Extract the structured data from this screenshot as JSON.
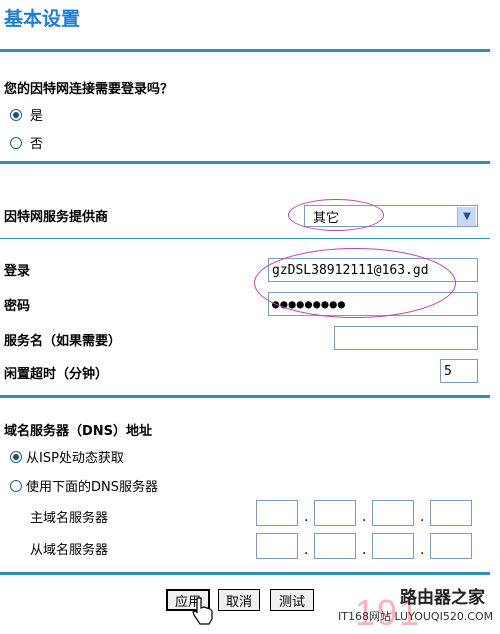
{
  "page": {
    "title": "基本设置"
  },
  "login_required": {
    "question": "您的因特网连接需要登录吗？",
    "options": [
      {
        "label": "是",
        "selected": true
      },
      {
        "label": "否",
        "selected": false
      }
    ]
  },
  "isp": {
    "label": "因特网服务提供商",
    "selected": "其它"
  },
  "account": {
    "login_label": "登录",
    "login_value": "gzDSL38912111@163.gd",
    "password_label": "密码",
    "password_value": "●●●●●●●●●",
    "service_label": "服务名（如果需要）",
    "service_value": "",
    "idle_label": "闲置超时（分钟）",
    "idle_value": "5"
  },
  "dns": {
    "label": "域名服务器（DNS）地址",
    "options": [
      {
        "label": "从ISP处动态获取",
        "selected": true
      },
      {
        "label": "使用下面的DNS服务器",
        "selected": false
      }
    ],
    "primary_label": "主域名服务器",
    "secondary_label": "从域名服务器"
  },
  "buttons": {
    "apply": "应用",
    "cancel": "取消",
    "test": "测试"
  },
  "watermark": {
    "brand": "路由器之家",
    "digits": "191",
    "site": "IT168网站 LUYOUQI520.COM"
  },
  "colors": {
    "title": "#1f7ed2",
    "rule": "#2f8fb6",
    "annotation": "#b447b8"
  }
}
